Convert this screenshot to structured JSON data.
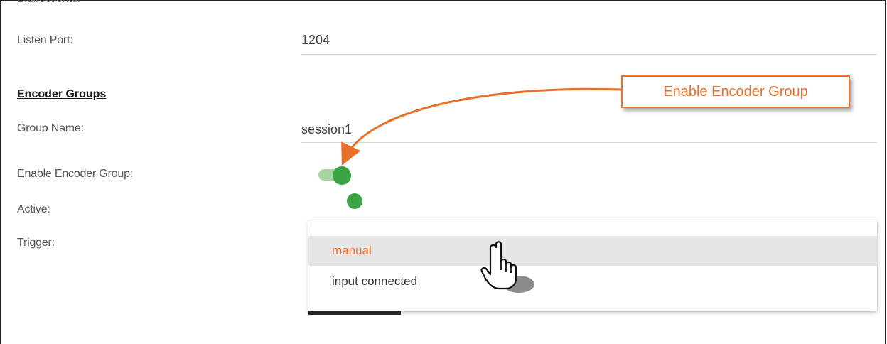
{
  "form": {
    "cut_label": "Bidirectional:",
    "listen_port_label": "Listen Port:",
    "listen_port_value": "1204",
    "section_title": "Encoder Groups",
    "group_name_label": "Group Name:",
    "group_name_value": "session1",
    "enable_label": "Enable Encoder Group:",
    "active_label": "Active:",
    "trigger_label": "Trigger:"
  },
  "dropdown": {
    "options": [
      "manual",
      "input connected"
    ],
    "highlighted": "manual"
  },
  "toggle": {
    "enabled": true
  },
  "active": true,
  "callout": {
    "text": "Enable Encoder Group"
  },
  "colors": {
    "accent_orange": "#e8702a",
    "status_green": "#3aa444",
    "toggle_track": "#a6d6a0"
  },
  "icons": {
    "cursor": "hand-pointer-icon",
    "arrow": "callout-arrow"
  }
}
